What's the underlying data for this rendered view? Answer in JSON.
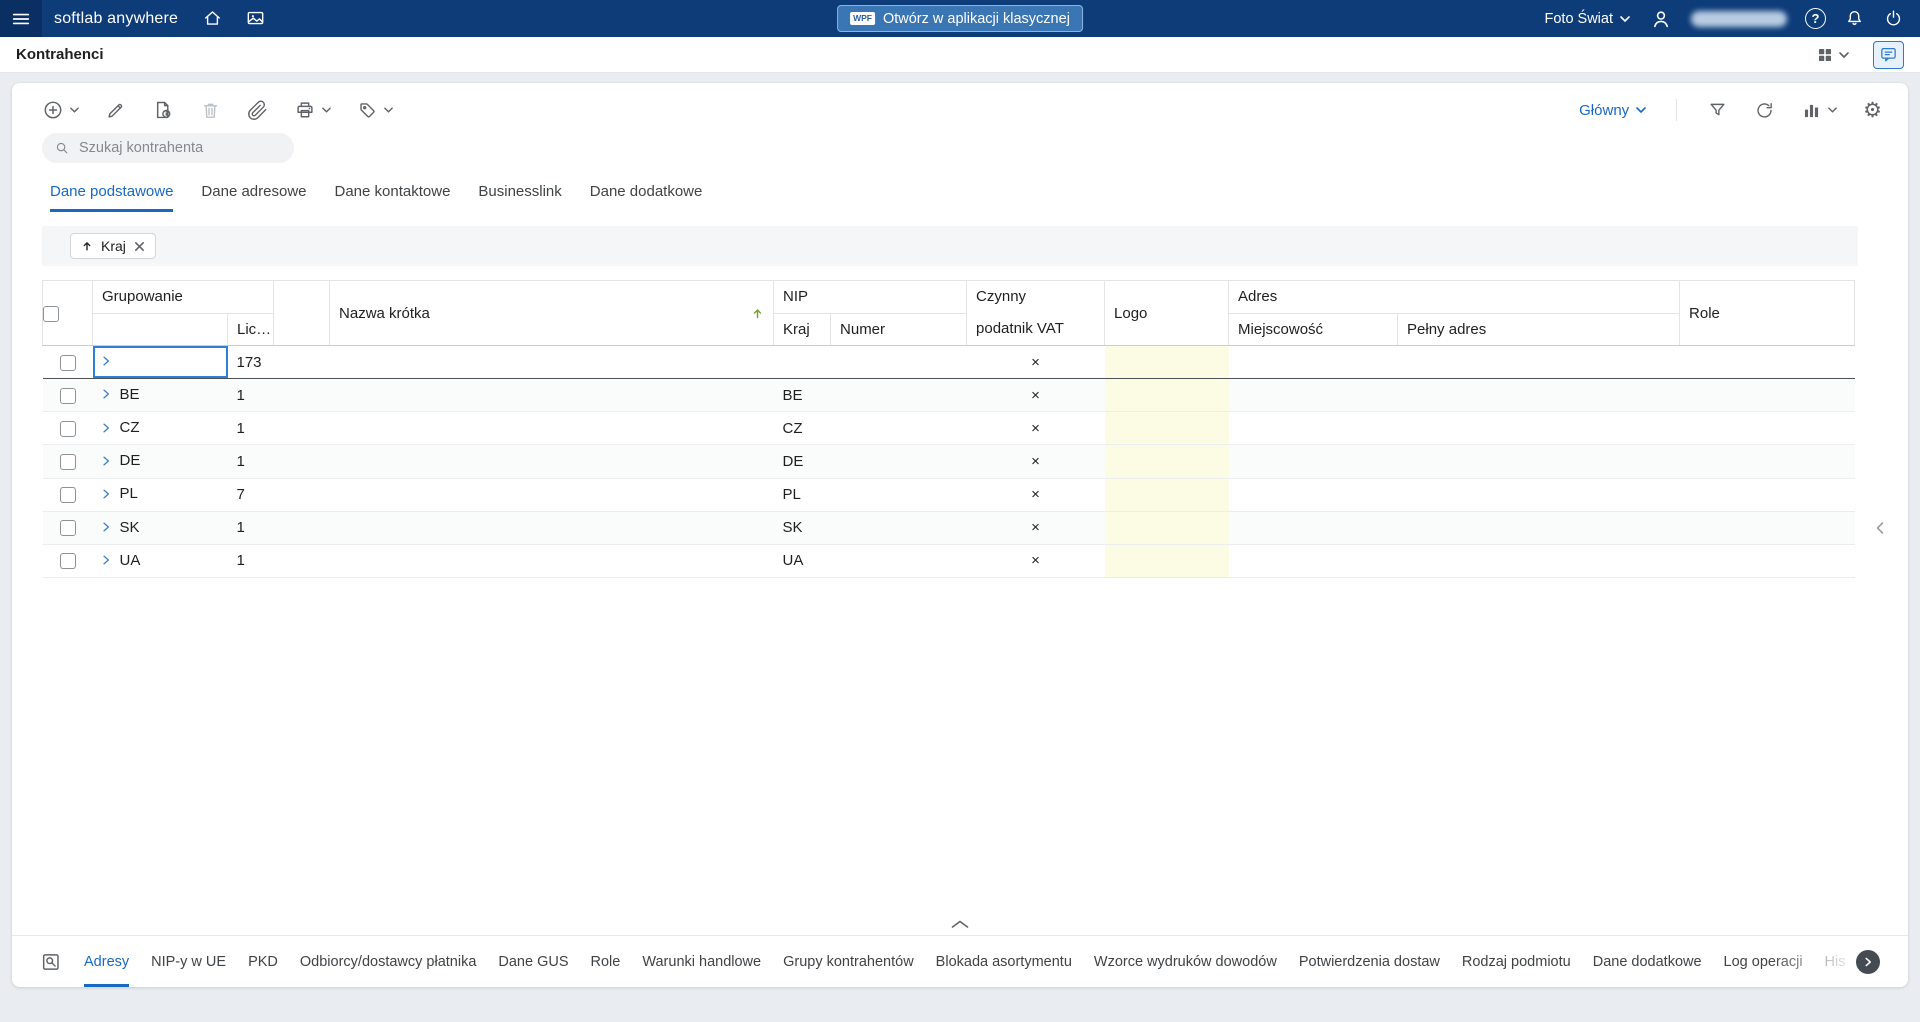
{
  "topbar": {
    "brand": "softlab anywhere",
    "classic_button": {
      "badge": "WPF",
      "label": "Otwórz w aplikacji klasycznej"
    },
    "company": "Foto Świat"
  },
  "titlebar": {
    "title": "Kontrahenci"
  },
  "toolbar": {
    "view": "Główny"
  },
  "search": {
    "placeholder": "Szukaj kontrahenta"
  },
  "tabs": [
    {
      "label": "Dane podstawowe",
      "active": true
    },
    {
      "label": "Dane adresowe",
      "active": false
    },
    {
      "label": "Dane kontaktowe",
      "active": false
    },
    {
      "label": "Businesslink",
      "active": false
    },
    {
      "label": "Dane dodatkowe",
      "active": false
    }
  ],
  "group_panel": {
    "chip": "Kraj"
  },
  "table": {
    "bands": {
      "grupowanie": "Grupowanie",
      "nip": "NIP",
      "adres": "Adres"
    },
    "headers": {
      "lic": "Lic…",
      "nazwa_krotka": "Nazwa krótka",
      "kraj": "Kraj",
      "numer": "Numer",
      "czynny_1": "Czynny",
      "czynny_2": "podatnik VAT",
      "logo": "Logo",
      "miejscowosc": "Miejscowość",
      "pelny_adres": "Pełny adres",
      "role": "Role"
    },
    "rows": [
      {
        "group": "",
        "count": "173",
        "nip_kraj": "",
        "vat": "×"
      },
      {
        "group": "BE",
        "count": "1",
        "nip_kraj": "BE",
        "vat": "×"
      },
      {
        "group": "CZ",
        "count": "1",
        "nip_kraj": "CZ",
        "vat": "×"
      },
      {
        "group": "DE",
        "count": "1",
        "nip_kraj": "DE",
        "vat": "×"
      },
      {
        "group": "PL",
        "count": "7",
        "nip_kraj": "PL",
        "vat": "×"
      },
      {
        "group": "SK",
        "count": "1",
        "nip_kraj": "SK",
        "vat": "×"
      },
      {
        "group": "UA",
        "count": "1",
        "nip_kraj": "UA",
        "vat": "×"
      }
    ]
  },
  "bottom_tabs": [
    {
      "label": "Adresy",
      "active": true
    },
    {
      "label": "NIP-y w UE",
      "active": false
    },
    {
      "label": "PKD",
      "active": false
    },
    {
      "label": "Odbiorcy/dostawcy płatnika",
      "active": false
    },
    {
      "label": "Dane GUS",
      "active": false
    },
    {
      "label": "Role",
      "active": false
    },
    {
      "label": "Warunki handlowe",
      "active": false
    },
    {
      "label": "Grupy kontrahentów",
      "active": false
    },
    {
      "label": "Blokada asortymentu",
      "active": false
    },
    {
      "label": "Wzorce wydruków dowodów",
      "active": false
    },
    {
      "label": "Potwierdzenia dostaw",
      "active": false
    },
    {
      "label": "Rodzaj podmiotu",
      "active": false
    },
    {
      "label": "Dane dodatkowe",
      "active": false
    },
    {
      "label": "Log operacji",
      "active": false
    },
    {
      "label": "His",
      "active": false
    }
  ],
  "icons": {
    "hamburger-icon": "menu",
    "home-icon": "house",
    "gallery-icon": "picture",
    "chevron-down-icon": "▾",
    "avatar-icon": "person",
    "help-icon": "?",
    "bell-icon": "notifications",
    "power-icon": "power",
    "layout-grid-icon": "grid",
    "comments-icon": "speech-bubble",
    "add-icon": "plus-circle",
    "edit-icon": "pencil",
    "document-info-icon": "page-info",
    "delete-icon": "trash",
    "attachment-icon": "paperclip",
    "print-icon": "printer",
    "tag-icon": "label",
    "filter-icon": "funnel",
    "refresh-icon": "circular-arrow",
    "chart-icon": "bar-chart",
    "settings-icon": "⚙",
    "search-icon": "magnifier",
    "sort-asc-icon": "arrow-up",
    "remove-icon": "x",
    "expand-icon": "chevron-right",
    "collapse-up-icon": "chevron-up",
    "collapse-right-panel-icon": "chevron-left",
    "panel-search-icon": "magnifier-document",
    "next-tabs-icon": "chevron-right-circle"
  },
  "colors": {
    "topbar_bg": "#0d3c79",
    "accent_blue": "#1769c5",
    "classic_button_bg": "#3b76b4",
    "logo_cell_bg": "#fbfce3",
    "focused_cell_border": "#2e80d6"
  }
}
